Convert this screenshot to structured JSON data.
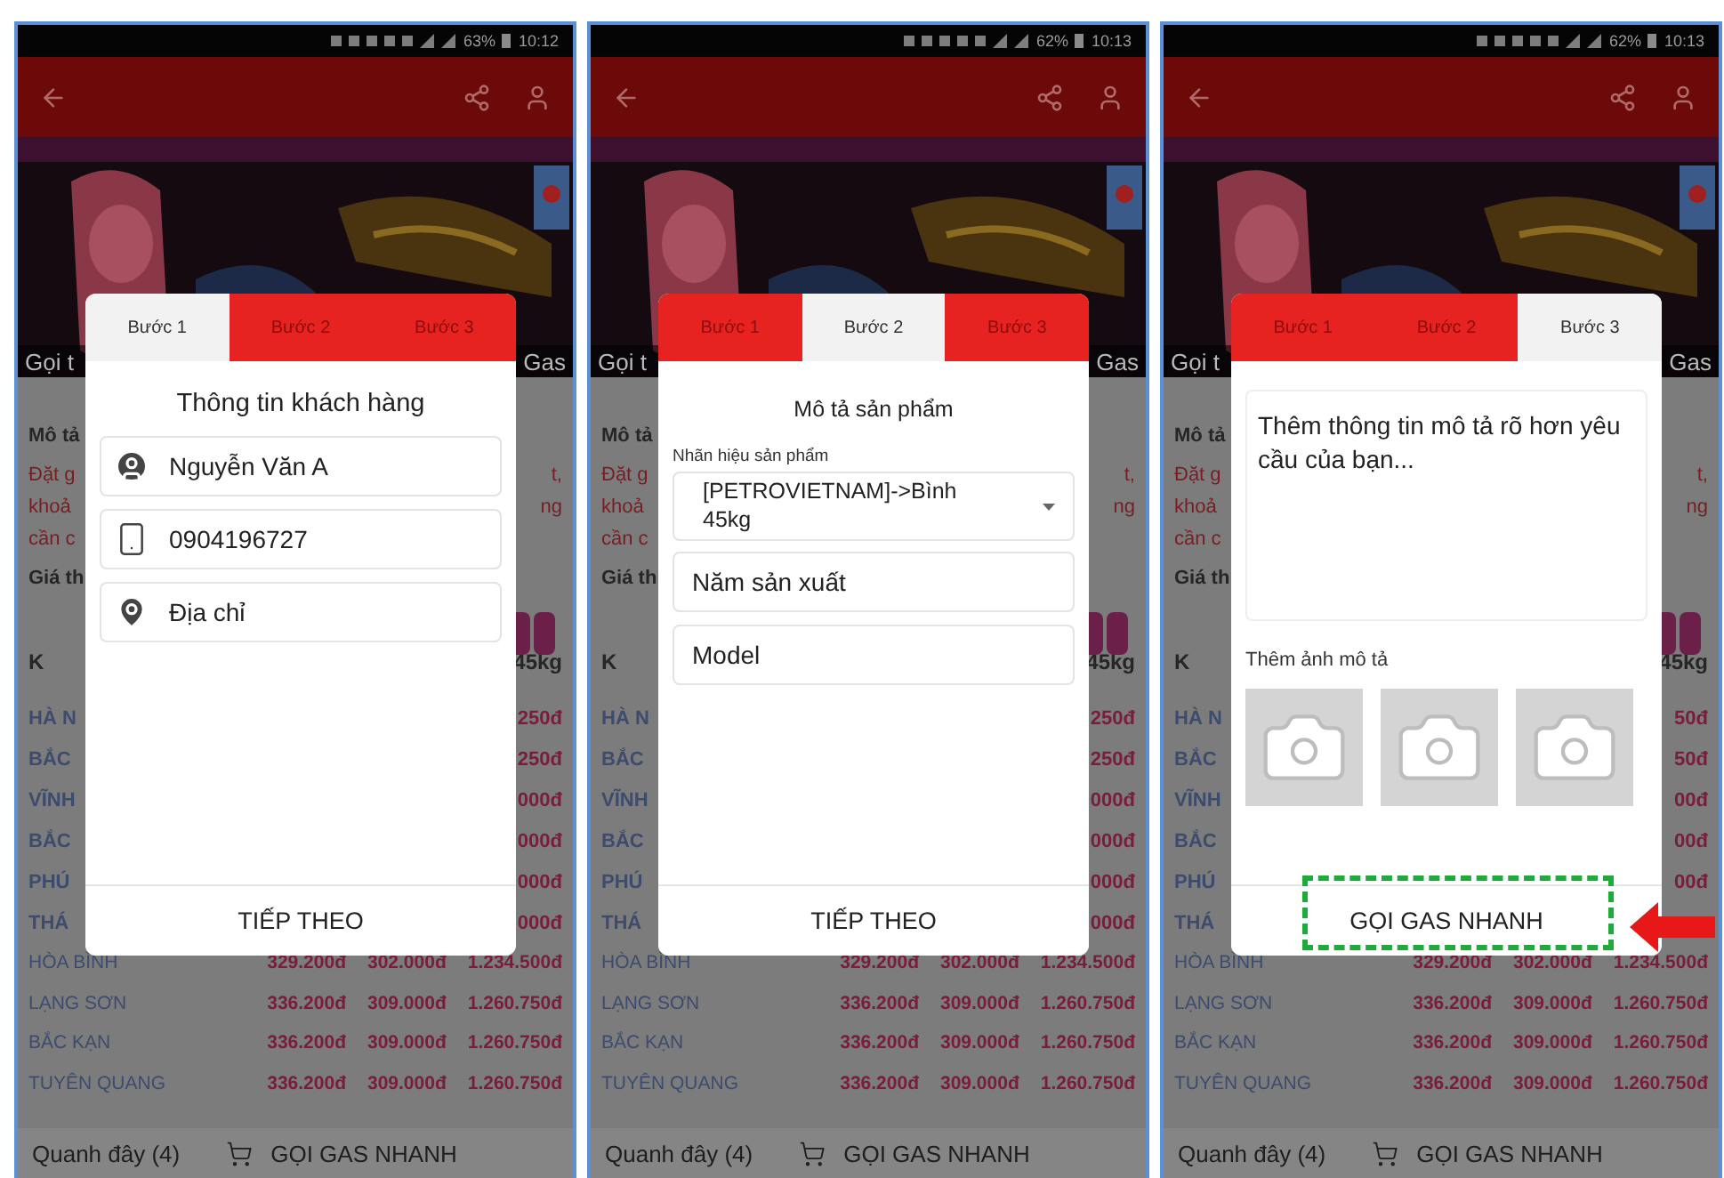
{
  "phones": [
    {
      "status": {
        "battery": "63%",
        "time": "10:12"
      },
      "caption": {
        "left": "Gọi t",
        "right": "Gas"
      },
      "notes": [
        {
          "kind": "heading",
          "left": "Mô tả"
        },
        {
          "kind": "note",
          "left": "Đặt g",
          "right": "t,"
        },
        {
          "kind": "note",
          "left": "khoả",
          "right": "ng"
        },
        {
          "kind": "note",
          "left": "cần c"
        },
        {
          "kind": "heading",
          "left": "Giá th"
        },
        {
          "kind": "header",
          "left": "K",
          "right": "45kg"
        }
      ],
      "rows": [
        {
          "kind": "partial",
          "left": "HÀ N",
          "right": "250đ"
        },
        {
          "kind": "partial",
          "left": "BẮC",
          "right": "250đ"
        },
        {
          "kind": "partial",
          "left": "VĨNH",
          "right": "000đ"
        },
        {
          "kind": "partial",
          "left": "BẮC",
          "right": "000đ"
        },
        {
          "kind": "partial",
          "left": "PHÚ",
          "right": "000đ"
        },
        {
          "kind": "partial",
          "left": "THÁ",
          "right": "000đ"
        },
        {
          "kind": "full",
          "place": "HÒA BÌNH",
          "prices": [
            "329.200đ",
            "302.000đ",
            "1.234.500đ"
          ]
        },
        {
          "kind": "full",
          "place": "LẠNG SƠN",
          "prices": [
            "336.200đ",
            "309.000đ",
            "1.260.750đ"
          ]
        },
        {
          "kind": "full",
          "place": "BẮC KẠN",
          "prices": [
            "336.200đ",
            "309.000đ",
            "1.260.750đ"
          ]
        },
        {
          "kind": "full",
          "place": "TUYÊN QUANG",
          "prices": [
            "336.200đ",
            "309.000đ",
            "1.260.750đ"
          ]
        }
      ],
      "bottom_bar": {
        "nearby": "Quanh đây (4)",
        "order": "GỌI GAS NHANH"
      },
      "dialog": {
        "kind": "customer",
        "tabs": [
          {
            "label": "Bước 1",
            "selected": true
          },
          {
            "label": "Bước 2",
            "selected": false
          },
          {
            "label": "Bước 3",
            "selected": false
          }
        ],
        "title": "Thông tin khách hàng",
        "fields": [
          {
            "value": "Nguyễn Văn A"
          },
          {
            "value": "0904196727"
          },
          {
            "placeholder": "Địa chỉ"
          }
        ],
        "button": "TIẾP THEO",
        "highlighted": false
      }
    },
    {
      "status": {
        "battery": "62%",
        "time": "10:13"
      },
      "caption": {
        "left": "Gọi t",
        "right": "Gas"
      },
      "notes": [
        {
          "kind": "heading",
          "left": "Mô tả"
        },
        {
          "kind": "note",
          "left": "Đặt g",
          "right": "t,"
        },
        {
          "kind": "note",
          "left": "khoả",
          "right": "ng"
        },
        {
          "kind": "note",
          "left": "cần c"
        },
        {
          "kind": "heading",
          "left": "Giá th"
        },
        {
          "kind": "header",
          "left": "K",
          "right": "45kg"
        }
      ],
      "rows": [
        {
          "kind": "partial",
          "left": "HÀ N",
          "right": "250đ"
        },
        {
          "kind": "partial",
          "left": "BẮC",
          "right": "250đ"
        },
        {
          "kind": "partial",
          "left": "VĨNH",
          "right": "000đ"
        },
        {
          "kind": "partial",
          "left": "BẮC",
          "right": "000đ"
        },
        {
          "kind": "partial",
          "left": "PHÚ",
          "right": "000đ"
        },
        {
          "kind": "partial",
          "left": "THÁ",
          "right": "000đ"
        },
        {
          "kind": "full",
          "place": "HÒA BÌNH",
          "prices": [
            "329.200đ",
            "302.000đ",
            "1.234.500đ"
          ]
        },
        {
          "kind": "full",
          "place": "LẠNG SƠN",
          "prices": [
            "336.200đ",
            "309.000đ",
            "1.260.750đ"
          ]
        },
        {
          "kind": "full",
          "place": "BẮC KẠN",
          "prices": [
            "336.200đ",
            "309.000đ",
            "1.260.750đ"
          ]
        },
        {
          "kind": "full",
          "place": "TUYÊN QUANG",
          "prices": [
            "336.200đ",
            "309.000đ",
            "1.260.750đ"
          ]
        }
      ],
      "bottom_bar": {
        "nearby": "Quanh đây (4)",
        "order": "GỌI GAS NHANH"
      },
      "dialog": {
        "kind": "product",
        "tabs": [
          {
            "label": "Bước 1",
            "selected": false
          },
          {
            "label": "Bước 2",
            "selected": true
          },
          {
            "label": "Bước 3",
            "selected": false
          }
        ],
        "title": "Mô tả sản phẩm",
        "select_label": "Nhãn hiệu sản phẩm",
        "select_value": "[PETROVIETNAM]->Bình 45kg",
        "fields": [
          {
            "placeholder": "Năm sản xuất"
          },
          {
            "placeholder": "Model"
          }
        ],
        "button": "TIẾP THEO",
        "highlighted": false
      }
    },
    {
      "status": {
        "battery": "62%",
        "time": "10:13"
      },
      "caption": {
        "left": "Gọi t",
        "right": "Gas"
      },
      "notes": [
        {
          "kind": "heading",
          "left": "Mô tả"
        },
        {
          "kind": "note",
          "left": "Đặt g",
          "right": "t,"
        },
        {
          "kind": "note",
          "left": "khoả",
          "right": "ng"
        },
        {
          "kind": "note",
          "left": "cần c"
        },
        {
          "kind": "heading",
          "left": "Giá th"
        },
        {
          "kind": "header",
          "left": "K",
          "right": "45kg"
        }
      ],
      "rows": [
        {
          "kind": "partial",
          "left": "HÀ N",
          "right": "50đ"
        },
        {
          "kind": "partial",
          "left": "BẮC",
          "right": "50đ"
        },
        {
          "kind": "partial",
          "left": "VĨNH",
          "right": "00đ"
        },
        {
          "kind": "partial",
          "left": "BẮC",
          "right": "00đ"
        },
        {
          "kind": "partial",
          "left": "PHÚ",
          "right": "00đ"
        },
        {
          "kind": "partial",
          "left": "THÁ"
        },
        {
          "kind": "full",
          "place": "HÒA BÌNH",
          "prices": [
            "329.200đ",
            "302.000đ",
            "1.234.500đ"
          ]
        },
        {
          "kind": "full",
          "place": "LẠNG SƠN",
          "prices": [
            "336.200đ",
            "309.000đ",
            "1.260.750đ"
          ]
        },
        {
          "kind": "full",
          "place": "BẮC KẠN",
          "prices": [
            "336.200đ",
            "309.000đ",
            "1.260.750đ"
          ]
        },
        {
          "kind": "full",
          "place": "TUYÊN QUANG",
          "prices": [
            "336.200đ",
            "309.000đ",
            "1.260.750đ"
          ]
        }
      ],
      "bottom_bar": {
        "nearby": "Quanh đây (4)",
        "order": "GỌI GAS NHANH"
      },
      "dialog": {
        "kind": "details",
        "tabs": [
          {
            "label": "Bước 1",
            "selected": false
          },
          {
            "label": "Bước 2",
            "selected": false
          },
          {
            "label": "Bước 3",
            "selected": true
          }
        ],
        "textarea_placeholder": "Thêm thông tin mô tả rõ hơn yêu cầu của bạn...",
        "photos_label": "Thêm ảnh mô tả",
        "button": "GỌI GAS NHANH",
        "highlighted": true
      }
    }
  ]
}
